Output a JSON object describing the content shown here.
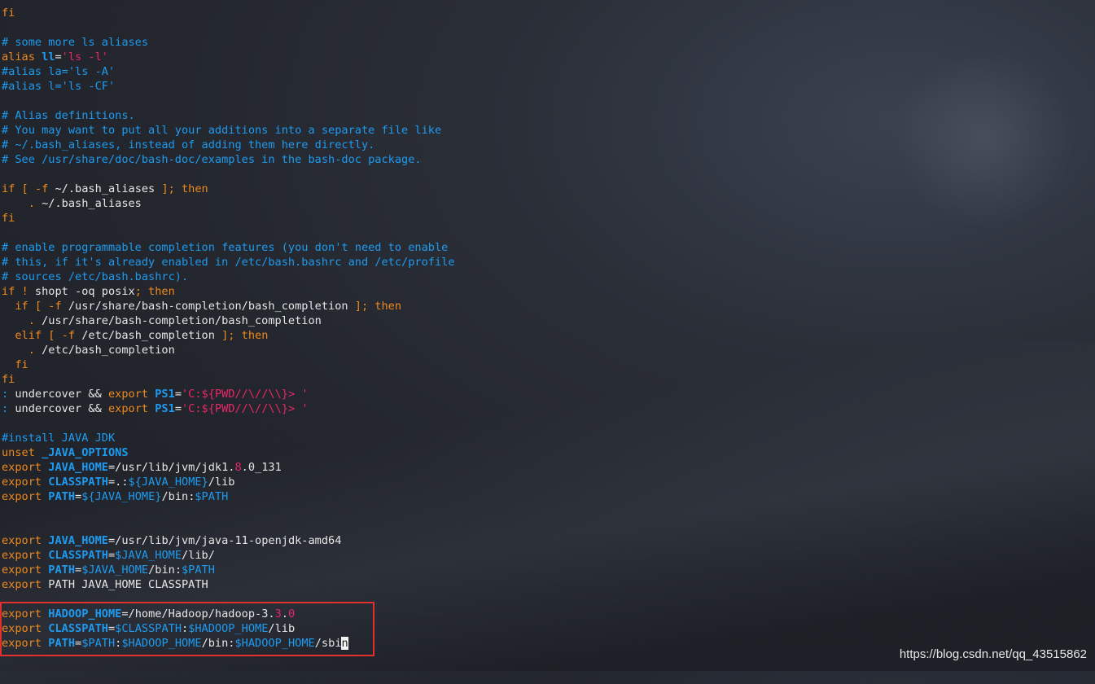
{
  "lines": [
    [
      {
        "t": "fi",
        "c": "kw"
      }
    ],
    [],
    [
      {
        "t": "# some more ls aliases",
        "c": "cm"
      }
    ],
    [
      {
        "t": "alias ",
        "c": "kw"
      },
      {
        "t": "ll",
        "c": "var"
      },
      {
        "t": "=",
        "c": "txt"
      },
      {
        "t": "'ls -l'",
        "c": "str"
      }
    ],
    [
      {
        "t": "#alias la='ls -A'",
        "c": "cm"
      }
    ],
    [
      {
        "t": "#alias l='ls -CF'",
        "c": "cm"
      }
    ],
    [],
    [
      {
        "t": "# Alias definitions.",
        "c": "cm"
      }
    ],
    [
      {
        "t": "# You may want to put all your additions into a separate file like",
        "c": "cm"
      }
    ],
    [
      {
        "t": "# ~/.bash_aliases, instead of adding them here directly.",
        "c": "cm"
      }
    ],
    [
      {
        "t": "# See /usr/share/doc/bash-doc/examples in the bash-doc package.",
        "c": "cm"
      }
    ],
    [],
    [
      {
        "t": "if [ -f ",
        "c": "kw"
      },
      {
        "t": "~/.bash_aliases ",
        "c": "txt"
      },
      {
        "t": "]; then",
        "c": "kw"
      }
    ],
    [
      {
        "t": "    . ",
        "c": "kw"
      },
      {
        "t": "~/.bash_aliases",
        "c": "txt"
      }
    ],
    [
      {
        "t": "fi",
        "c": "kw"
      }
    ],
    [],
    [
      {
        "t": "# enable programmable completion features (you don't need to enable",
        "c": "cm"
      }
    ],
    [
      {
        "t": "# this, if it's already enabled in /etc/bash.bashrc and /etc/profile",
        "c": "cm"
      }
    ],
    [
      {
        "t": "# sources /etc/bash.bashrc).",
        "c": "cm"
      }
    ],
    [
      {
        "t": "if ! ",
        "c": "kw"
      },
      {
        "t": "shopt -oq posix",
        "c": "txt"
      },
      {
        "t": "; then",
        "c": "kw"
      }
    ],
    [
      {
        "t": "  if [ -f ",
        "c": "kw"
      },
      {
        "t": "/usr/share/bash-completion/bash_completion ",
        "c": "txt"
      },
      {
        "t": "]; then",
        "c": "kw"
      }
    ],
    [
      {
        "t": "    . ",
        "c": "kw"
      },
      {
        "t": "/usr/share/bash-completion/bash_completion",
        "c": "txt"
      }
    ],
    [
      {
        "t": "  elif [ -f ",
        "c": "kw"
      },
      {
        "t": "/etc/bash_completion ",
        "c": "txt"
      },
      {
        "t": "]; then",
        "c": "kw"
      }
    ],
    [
      {
        "t": "    . ",
        "c": "kw"
      },
      {
        "t": "/etc/bash_completion",
        "c": "txt"
      }
    ],
    [
      {
        "t": "  fi",
        "c": "kw"
      }
    ],
    [
      {
        "t": "fi",
        "c": "kw"
      }
    ],
    [
      {
        "t": ": ",
        "c": "cm"
      },
      {
        "t": "undercover && ",
        "c": "txt"
      },
      {
        "t": "export ",
        "c": "kw"
      },
      {
        "t": "PS1",
        "c": "var"
      },
      {
        "t": "=",
        "c": "txt"
      },
      {
        "t": "'C:${PWD//\\//\\\\}> '",
        "c": "str"
      }
    ],
    [
      {
        "t": ": ",
        "c": "cm"
      },
      {
        "t": "undercover && ",
        "c": "txt"
      },
      {
        "t": "export ",
        "c": "kw"
      },
      {
        "t": "PS1",
        "c": "var"
      },
      {
        "t": "=",
        "c": "txt"
      },
      {
        "t": "'C:${PWD//\\//\\\\}> '",
        "c": "str"
      }
    ],
    [],
    [
      {
        "t": "#install JAVA JDK",
        "c": "cm"
      }
    ],
    [
      {
        "t": "unset ",
        "c": "kw"
      },
      {
        "t": "_JAVA_OPTIONS",
        "c": "var"
      }
    ],
    [
      {
        "t": "export ",
        "c": "kw"
      },
      {
        "t": "JAVA_HOME",
        "c": "var"
      },
      {
        "t": "=/usr/lib/jvm/jdk1.",
        "c": "txt"
      },
      {
        "t": "8",
        "c": "num"
      },
      {
        "t": ".0_131",
        "c": "txt"
      }
    ],
    [
      {
        "t": "export ",
        "c": "kw"
      },
      {
        "t": "CLASSPATH",
        "c": "var"
      },
      {
        "t": "=.:",
        "c": "txt"
      },
      {
        "t": "${JAVA_HOME}",
        "c": "cm"
      },
      {
        "t": "/lib",
        "c": "txt"
      }
    ],
    [
      {
        "t": "export ",
        "c": "kw"
      },
      {
        "t": "PATH",
        "c": "var"
      },
      {
        "t": "=",
        "c": "txt"
      },
      {
        "t": "${JAVA_HOME}",
        "c": "cm"
      },
      {
        "t": "/bin:",
        "c": "txt"
      },
      {
        "t": "$PATH",
        "c": "cm"
      }
    ],
    [],
    [],
    [
      {
        "t": "export ",
        "c": "kw"
      },
      {
        "t": "JAVA_HOME",
        "c": "var"
      },
      {
        "t": "=/usr/lib/jvm/java-11-openjdk-amd64",
        "c": "txt"
      }
    ],
    [
      {
        "t": "export ",
        "c": "kw"
      },
      {
        "t": "CLASSPATH",
        "c": "var"
      },
      {
        "t": "=",
        "c": "txt"
      },
      {
        "t": "$JAVA_HOME",
        "c": "cm"
      },
      {
        "t": "/lib/",
        "c": "txt"
      }
    ],
    [
      {
        "t": "export ",
        "c": "kw"
      },
      {
        "t": "PATH",
        "c": "var"
      },
      {
        "t": "=",
        "c": "txt"
      },
      {
        "t": "$JAVA_HOME",
        "c": "cm"
      },
      {
        "t": "/bin:",
        "c": "txt"
      },
      {
        "t": "$PATH",
        "c": "cm"
      }
    ],
    [
      {
        "t": "export ",
        "c": "kw"
      },
      {
        "t": "PATH JAVA_HOME CLASSPATH",
        "c": "txt"
      }
    ],
    [],
    [
      {
        "t": "export ",
        "c": "kw"
      },
      {
        "t": "HADOOP_HOME",
        "c": "var"
      },
      {
        "t": "=/home/Hadoop/hadoop-3.",
        "c": "txt"
      },
      {
        "t": "3",
        "c": "num"
      },
      {
        "t": ".",
        "c": "txt"
      },
      {
        "t": "0",
        "c": "num"
      }
    ],
    [
      {
        "t": "export ",
        "c": "kw"
      },
      {
        "t": "CLASSPATH",
        "c": "var"
      },
      {
        "t": "=",
        "c": "txt"
      },
      {
        "t": "$CLASSPATH",
        "c": "cm"
      },
      {
        "t": ":",
        "c": "txt"
      },
      {
        "t": "$HADOOP_HOME",
        "c": "cm"
      },
      {
        "t": "/lib",
        "c": "txt"
      }
    ],
    [
      {
        "t": "export ",
        "c": "kw"
      },
      {
        "t": "PATH",
        "c": "var"
      },
      {
        "t": "=",
        "c": "txt"
      },
      {
        "t": "$PATH",
        "c": "cm"
      },
      {
        "t": ":",
        "c": "txt"
      },
      {
        "t": "$HADOOP_HOME",
        "c": "cm"
      },
      {
        "t": "/bin:",
        "c": "txt"
      },
      {
        "t": "$HADOOP_HOME",
        "c": "cm"
      },
      {
        "t": "/sbi",
        "c": "txt"
      },
      {
        "t": "n",
        "c": "cursor"
      }
    ]
  ],
  "watermark": "https://blog.csdn.net/qq_43515862"
}
